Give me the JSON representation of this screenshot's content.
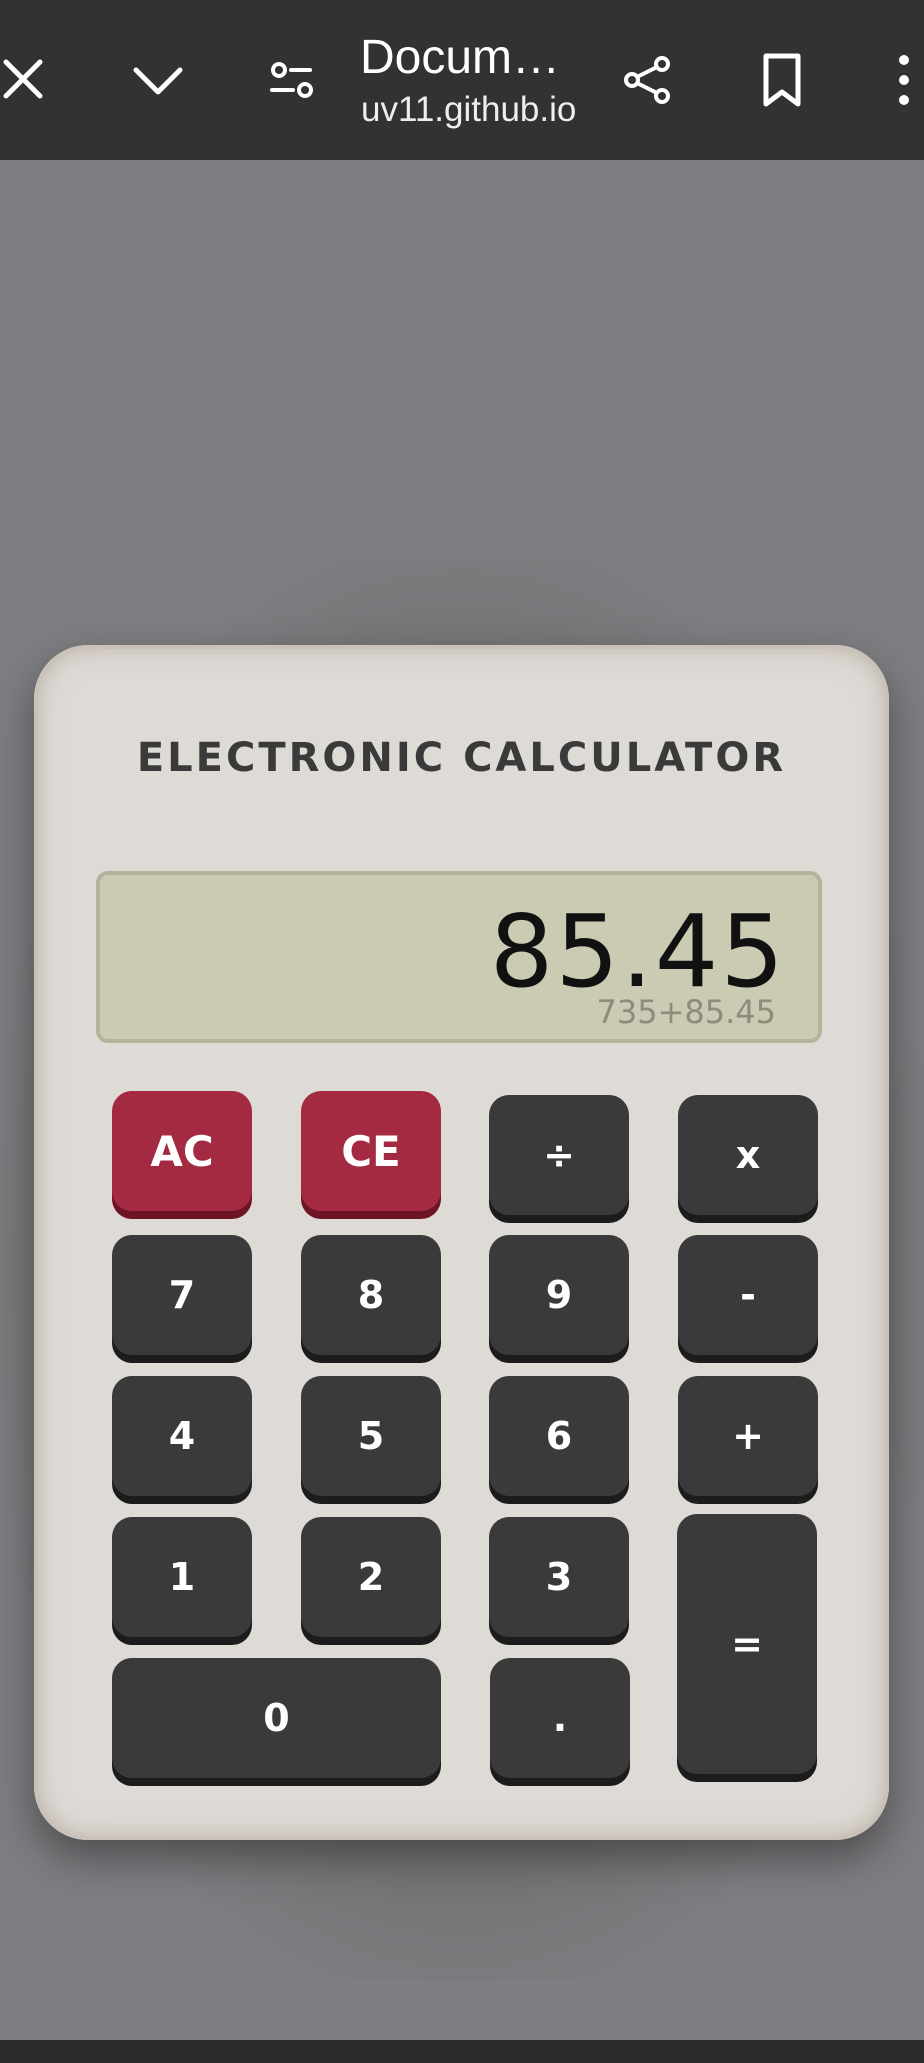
{
  "browser": {
    "title": "Docum…",
    "url": "uv11.github.io",
    "icons": [
      "close-icon",
      "chevron-down-icon",
      "site-settings-icon",
      "share-icon",
      "bookmark-icon",
      "more-vert-icon"
    ]
  },
  "calculator": {
    "title": "ELECTRONIC CALCULATOR",
    "display": {
      "value": "85.45",
      "expression": "735+85.45"
    },
    "colors": {
      "body": "#dedbd7",
      "screen": "#cacbb2",
      "key": "#3a3a3a",
      "clear_key": "#a32a40"
    },
    "keys": {
      "ac": "AC",
      "ce": "CE",
      "divide": "÷",
      "multiply": "x",
      "seven": "7",
      "eight": "8",
      "nine": "9",
      "minus": "-",
      "four": "4",
      "five": "5",
      "six": "6",
      "plus": "+",
      "one": "1",
      "two": "2",
      "three": "3",
      "equals": "=",
      "zero": "0",
      "dot": "."
    }
  }
}
